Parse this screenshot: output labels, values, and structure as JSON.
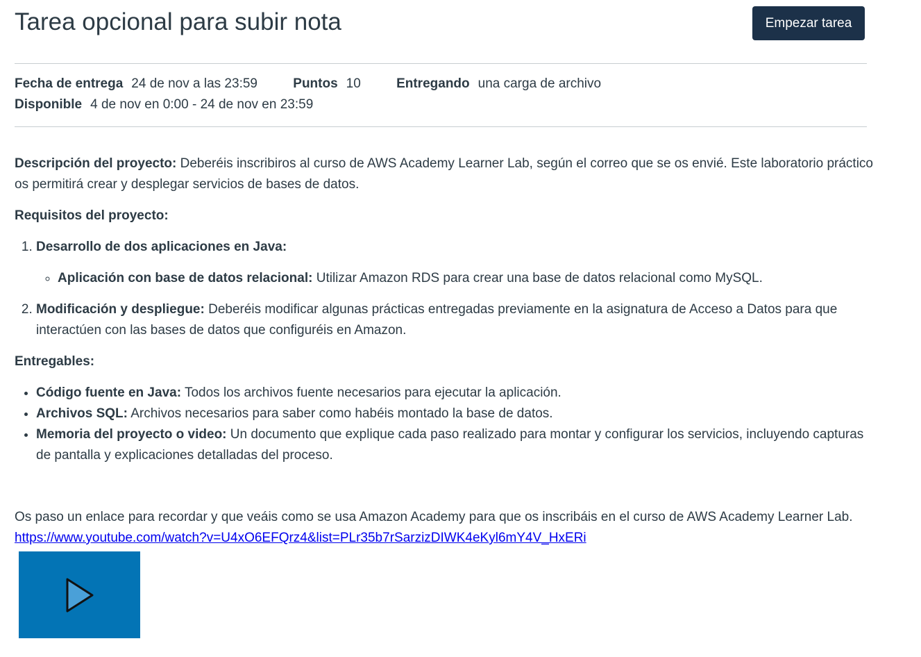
{
  "header": {
    "title": "Tarea opcional para subir nota",
    "start_button": "Empezar tarea"
  },
  "meta": {
    "due_label": "Fecha de entrega",
    "due_value": "24 de nov a las 23:59",
    "points_label": "Puntos",
    "points_value": "10",
    "submitting_label": "Entregando",
    "submitting_value": "una carga de archivo",
    "available_label": "Disponible",
    "available_value": "4 de nov en 0:00 - 24 de nov en 23:59"
  },
  "body": {
    "desc_label": "Descripción del proyecto:",
    "desc_text": " Deberéis inscribiros al curso de AWS Academy Learner Lab, según el correo que se os envié. Este laboratorio práctico os permitirá crear y desplegar servicios de bases de datos.",
    "requirements_heading": "Requisitos del proyecto:",
    "req1_title": "Desarrollo de dos aplicaciones en Java:",
    "req1_sub_label": "Aplicación con base de datos relacional:",
    "req1_sub_text": " Utilizar Amazon RDS para crear una base de datos relacional como MySQL.",
    "req2_label": "Modificación y despliegue:",
    "req2_text": " Deberéis modificar algunas prácticas entregadas previamente en la asignatura de Acceso a Datos para que interactúen con las bases de datos que configuréis en Amazon.",
    "deliverables_heading": "Entregables:",
    "deliv1_label": "Código fuente en Java:",
    "deliv1_text": " Todos los archivos fuente necesarios para ejecutar la aplicación.",
    "deliv2_label": "Archivos SQL:",
    "deliv2_text": " Archivos necesarios para saber como habéis montado la base de datos.",
    "deliv3_label": "Memoria del proyecto o video:",
    "deliv3_text": " Un documento que explique cada paso realizado para montar y configurar los servicios, incluyendo capturas de pantalla y explicaciones detalladas del proceso.",
    "link_intro": "Os paso un enlace para recordar y que veáis como se usa Amazon Academy para que os inscribáis en el curso de AWS Academy Learner Lab.",
    "link_url": "https://www.youtube.com/watch?v=U4xO6EFQrz4&list=PLr35b7rSarzizDIWK4eKyl6mY4V_HxERi"
  },
  "video": {
    "icon": "play-icon"
  },
  "colors": {
    "button_bg": "#1c3149",
    "video_bg": "#0374b5",
    "text": "#2d3b45"
  }
}
